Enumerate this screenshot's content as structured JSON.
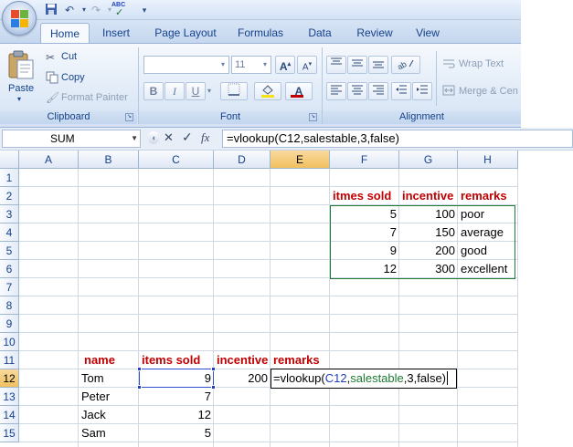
{
  "quick_access": {
    "save_icon": "save-icon",
    "undo_icon": "undo-icon",
    "redo_icon": "redo-icon",
    "spelling_icon": "spelling-icon",
    "spelling_label": "ABC"
  },
  "tabs": [
    {
      "label": "Home",
      "active": true
    },
    {
      "label": "Insert"
    },
    {
      "label": "Page Layout"
    },
    {
      "label": "Formulas"
    },
    {
      "label": "Data"
    },
    {
      "label": "Review"
    },
    {
      "label": "View"
    }
  ],
  "ribbon": {
    "clipboard": {
      "label": "Clipboard",
      "paste": "Paste",
      "cut": "Cut",
      "copy": "Copy",
      "format_painter": "Format Painter"
    },
    "font": {
      "label": "Font",
      "font_name": "",
      "font_size": "11",
      "grow": "A",
      "shrink": "A",
      "bold": "B",
      "italic": "I",
      "underline": "U",
      "font_color_letter": "A"
    },
    "alignment": {
      "label": "Alignment",
      "wrap_text": "Wrap Text",
      "merge_center": "Merge & Cen"
    }
  },
  "formula_bar": {
    "name_box": "SUM",
    "cancel": "✕",
    "enter": "✓",
    "fx": "fx",
    "formula": "=vlookup(C12,salestable,3,false)"
  },
  "grid": {
    "columns": [
      "A",
      "B",
      "C",
      "D",
      "E",
      "F",
      "G",
      "H"
    ],
    "selected_column": "E",
    "rows": [
      "1",
      "2",
      "3",
      "4",
      "5",
      "6",
      "7",
      "8",
      "9",
      "10",
      "11",
      "12",
      "13",
      "14",
      "15"
    ],
    "selected_row": "12",
    "lookup_table": {
      "headers": [
        "itmes sold",
        "incentive",
        "remarks"
      ],
      "rows": [
        [
          "5",
          "100",
          "poor"
        ],
        [
          "7",
          "150",
          "average"
        ],
        [
          "9",
          "200",
          "good"
        ],
        [
          "12",
          "300",
          "excellent"
        ]
      ]
    },
    "main_table": {
      "headers": [
        "name",
        "items sold",
        "incentive",
        "remarks"
      ],
      "rows": [
        [
          "Tom",
          "9",
          "200"
        ],
        [
          "Peter",
          "7",
          ""
        ],
        [
          "Jack",
          "12",
          ""
        ],
        [
          "Sam",
          "5",
          ""
        ]
      ]
    },
    "edit_cell": {
      "prefix": "=vlookup(",
      "ref1": "C12",
      "comma1": ",",
      "ref2": "salestable",
      "suffix": ",3,false)"
    }
  },
  "colors": {
    "header_red": "#c00000",
    "ref_blue": "#1f3fbf",
    "ref_green": "#1e7b34",
    "selection_orange": "#f1c15f"
  }
}
